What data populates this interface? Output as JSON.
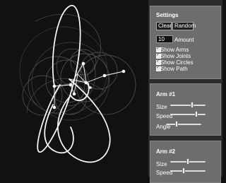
{
  "settings": {
    "title": "Settings",
    "clear_label": "Clear",
    "random_label": "Random",
    "amount_value": "10",
    "amount_label": "Amount",
    "checkboxes": [
      {
        "label": "Show Arms",
        "checked": true
      },
      {
        "label": "Show Joints",
        "checked": true
      },
      {
        "label": "Show Circles",
        "checked": true
      },
      {
        "label": "Show Path",
        "checked": true
      }
    ]
  },
  "arms": [
    {
      "title": "Arm #1",
      "size_label": "Size",
      "size_value": 0.62,
      "speed_label": "Speed",
      "speed_value": 0.75,
      "angle_label": "Angle",
      "angle_value": 0.28
    },
    {
      "title": "Arm #2",
      "size_label": "Size",
      "size_value": 0.5,
      "speed_label": "Speed",
      "speed_value": 0.38
    }
  ],
  "colors": {
    "canvas_bg": "#111111",
    "panel_bg": "#6d6d6d",
    "path_color": "#ffffff"
  }
}
